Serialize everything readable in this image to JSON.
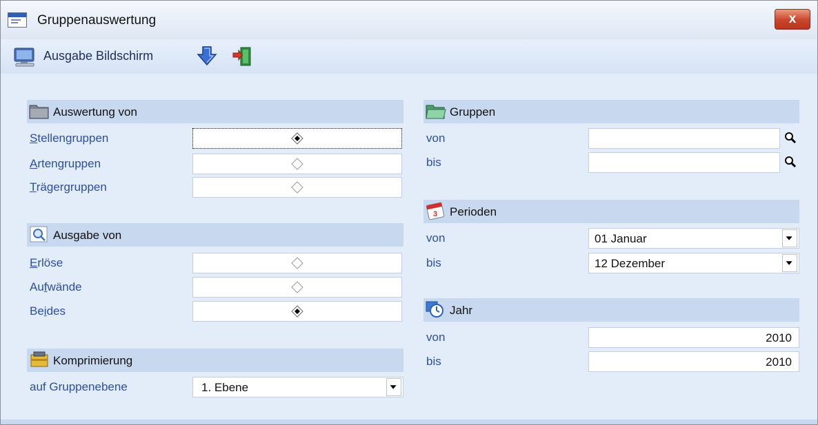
{
  "window": {
    "title": "Gruppenauswertung",
    "close_label": "x",
    "icons": {
      "app": "app-window-icon",
      "close": "close-icon"
    }
  },
  "toolbar": {
    "output_label": "Ausgabe Bildschirm",
    "icons": [
      "monitor-icon",
      "download-arrow-icon",
      "exit-door-icon"
    ]
  },
  "sections": {
    "auswertung": {
      "title": "Auswertung von",
      "icon": "folder-icon",
      "options": [
        {
          "hotkey": "S",
          "rest": "tellengruppen",
          "selected": true
        },
        {
          "hotkey": "A",
          "rest": "rtengruppen",
          "selected": false
        },
        {
          "hotkey": "T",
          "rest": "rägergruppen",
          "selected": false
        }
      ]
    },
    "ausgabe": {
      "title": "Ausgabe von",
      "icon": "magnifier-icon",
      "options": [
        {
          "pre": "",
          "hotkey": "E",
          "rest": "rlöse",
          "selected": false
        },
        {
          "pre": "Au",
          "hotkey": "f",
          "rest": "wände",
          "selected": false
        },
        {
          "pre": "Be",
          "hotkey": "i",
          "rest": "des",
          "selected": true
        }
      ]
    },
    "komprimierung": {
      "title": "Komprimierung",
      "icon": "compress-icon",
      "label": "auf Gruppenebene",
      "value": "1. Ebene"
    },
    "gruppen": {
      "title": "Gruppen",
      "icon": "folder-open-icon",
      "from_label": "von",
      "to_label": "bis",
      "from_value": "",
      "to_value": ""
    },
    "perioden": {
      "title": "Perioden",
      "icon": "calendar-icon",
      "from_label": "von",
      "to_label": "bis",
      "from_value": "01 Januar",
      "to_value": "12 Dezember"
    },
    "jahr": {
      "title": "Jahr",
      "icon": "clock-icon",
      "from_label": "von",
      "to_label": "bis",
      "from_value": "2010",
      "to_value": "2010"
    }
  },
  "colors": {
    "background": "#e3edfa",
    "section_header": "#c7d8ef",
    "label": "#2c4e9e",
    "close_button": "#c9442a"
  }
}
